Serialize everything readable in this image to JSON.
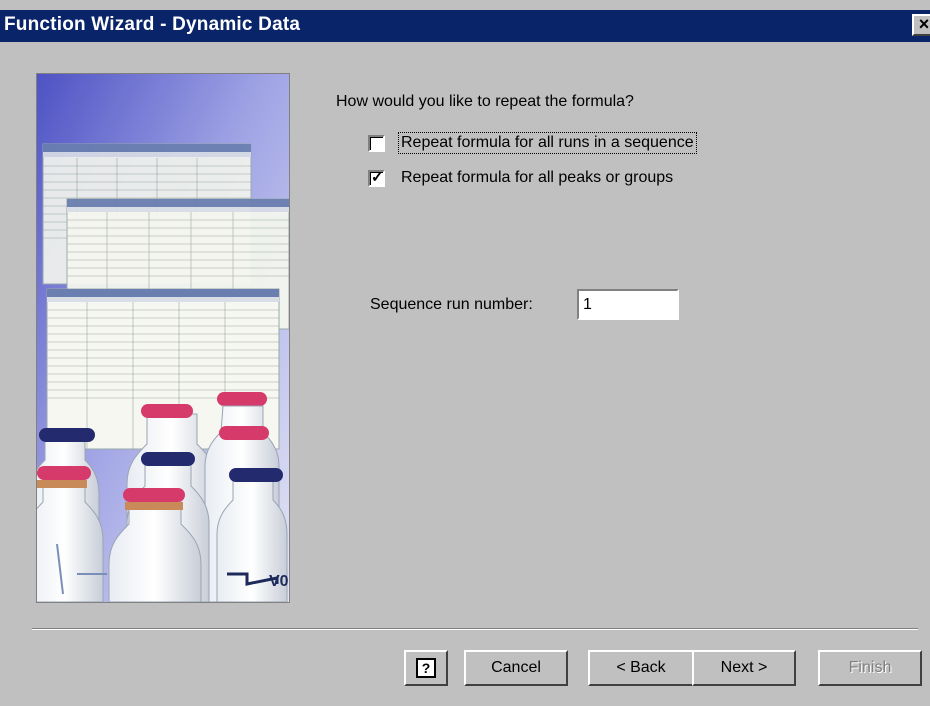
{
  "window": {
    "title": "Function Wizard - Dynamic Data",
    "close_label": "✕"
  },
  "main": {
    "question": "How would you like to repeat the formula?",
    "options": [
      {
        "label": "Repeat formula for all runs in a sequence",
        "checked": false
      },
      {
        "label": "Repeat formula for all peaks or groups",
        "checked": true
      }
    ],
    "sequence_run_label": "Sequence run number:",
    "sequence_run_value": "1"
  },
  "buttons": {
    "help_label": "?",
    "cancel_label": "Cancel",
    "back_label": "< Back",
    "next_label": "Next >",
    "finish_label": "Finish"
  },
  "picture": {
    "description_icon": "spreadsheets-and-vials-illustration"
  }
}
